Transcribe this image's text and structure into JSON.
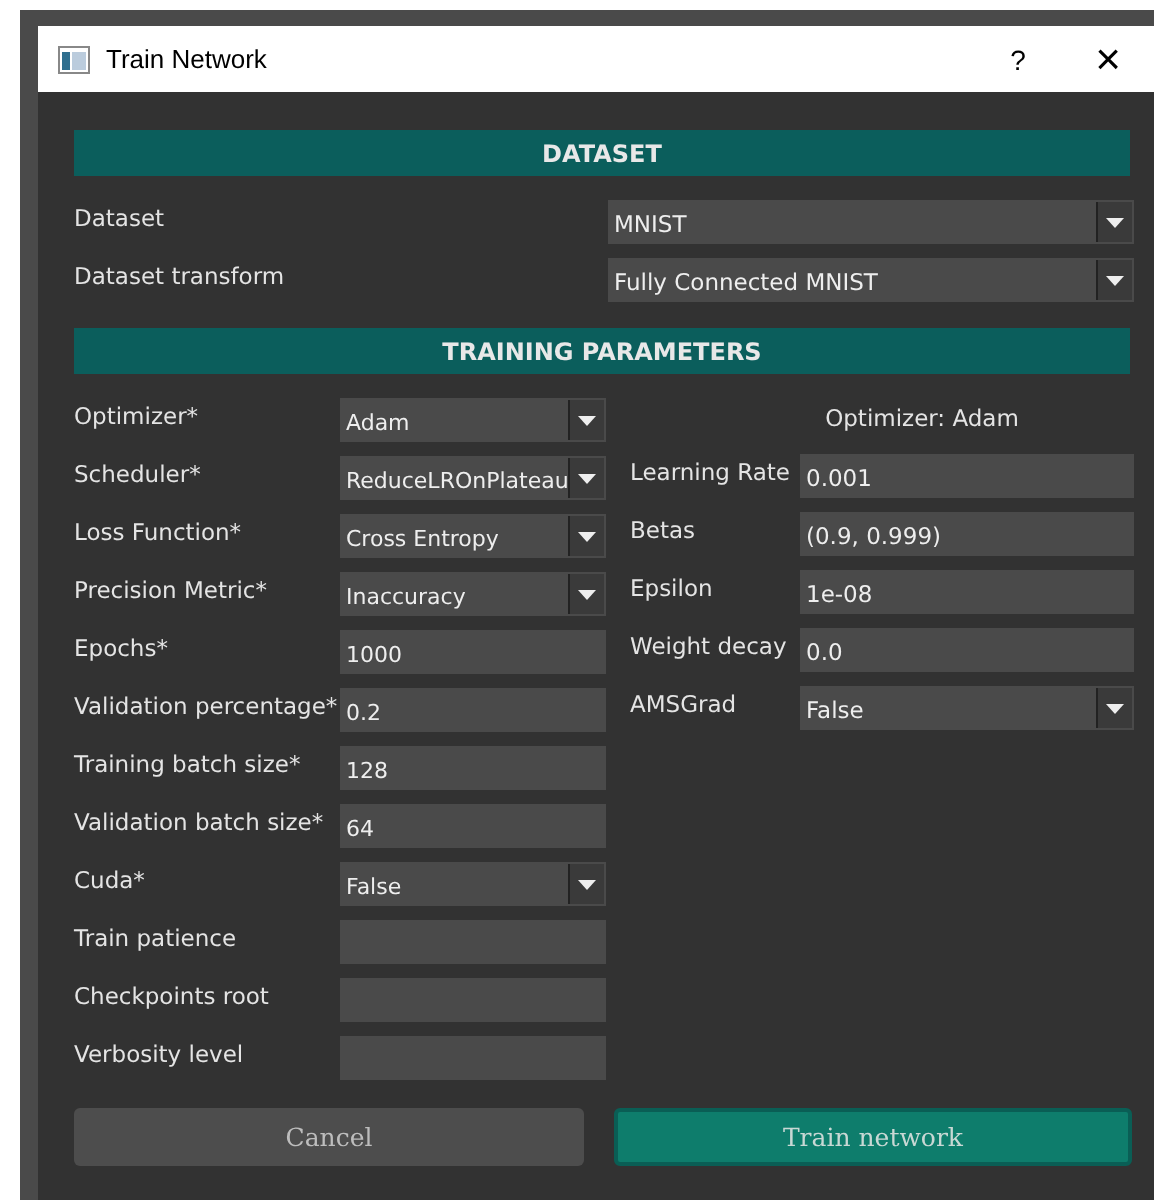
{
  "window": {
    "title": "Train Network",
    "help": "?",
    "close": "×"
  },
  "dataset": {
    "header": "DATASET",
    "fields": [
      {
        "label": "Dataset",
        "kind": "combo",
        "value": "MNIST"
      },
      {
        "label": "Dataset transform",
        "kind": "combo",
        "value": "Fully Connected MNIST"
      }
    ]
  },
  "training": {
    "header": "TRAINING PARAMETERS",
    "fields": [
      {
        "label": "Optimizer*",
        "kind": "combo",
        "value": "Adam"
      },
      {
        "label": "Scheduler*",
        "kind": "combo",
        "value": "ReduceLROnPlateau"
      },
      {
        "label": "Loss Function*",
        "kind": "combo",
        "value": "Cross Entropy"
      },
      {
        "label": "Precision Metric*",
        "kind": "combo",
        "value": "Inaccuracy"
      },
      {
        "label": "Epochs*",
        "kind": "text",
        "value": "1000"
      },
      {
        "label": "Validation percentage*",
        "kind": "text",
        "value": "0.2"
      },
      {
        "label": "Training batch size*",
        "kind": "text",
        "value": "128"
      },
      {
        "label": "Validation batch size*",
        "kind": "text",
        "value": "64"
      },
      {
        "label": "Cuda*",
        "kind": "combo",
        "value": "False"
      },
      {
        "label": "Train patience",
        "kind": "text"
      },
      {
        "label": "Checkpoints root",
        "kind": "text"
      },
      {
        "label": "Verbosity level",
        "kind": "text"
      }
    ]
  },
  "optimizer": {
    "title": "Optimizer: Adam",
    "fields": [
      {
        "label": "Learning Rate",
        "kind": "text",
        "value": "0.001"
      },
      {
        "label": "Betas",
        "kind": "text",
        "value": "(0.9, 0.999)"
      },
      {
        "label": "Epsilon",
        "kind": "text",
        "value": "1e-08"
      },
      {
        "label": "Weight decay",
        "kind": "text",
        "value": "0.0"
      },
      {
        "label": "AMSGrad",
        "kind": "combo",
        "value": "False"
      }
    ]
  },
  "buttons": [
    {
      "label": "Cancel",
      "kind": "secondary"
    },
    {
      "label": "Train network",
      "kind": "primary"
    }
  ]
}
